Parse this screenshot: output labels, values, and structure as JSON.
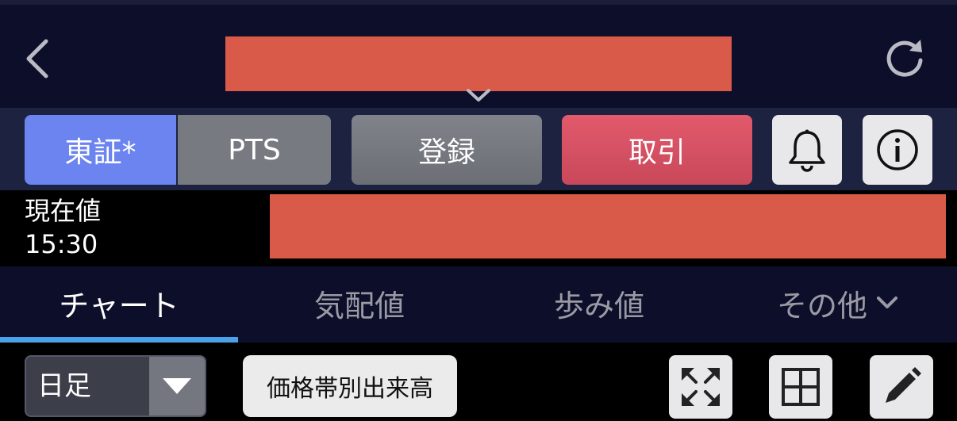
{
  "header": {
    "back_icon": "chevron-left-icon",
    "title_redacted": true,
    "dropdown_icon": "chevron-down-icon",
    "refresh_icon": "refresh-icon"
  },
  "market": {
    "tosho_label": "東証*",
    "pts_label": "PTS",
    "register_label": "登録",
    "trade_label": "取引",
    "alert_icon": "bell-icon",
    "info_icon": "info-icon",
    "colors": {
      "active": "#6b84f0",
      "trade": "#d8505f"
    }
  },
  "price": {
    "label": "現在値",
    "time": "15:30",
    "value_redacted": true
  },
  "tabs": [
    {
      "label": "チャート",
      "active": true
    },
    {
      "label": "気配値",
      "active": false
    },
    {
      "label": "歩み値",
      "active": false
    },
    {
      "label": "その他",
      "active": false
    }
  ],
  "toolbar": {
    "period_selected": "日足",
    "volume_by_price_label": "価格帯別出来高",
    "expand_icon": "expand-icon",
    "grid_icon": "grid-layout-icon",
    "draw_icon": "pencil-icon"
  },
  "colors": {
    "accent": "#4aa3ea",
    "redaction": "#d95a48"
  }
}
